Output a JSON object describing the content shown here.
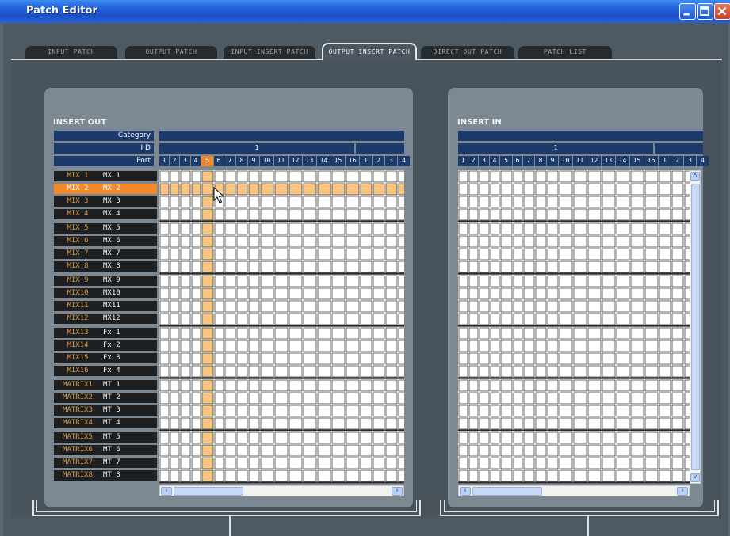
{
  "window": {
    "title": "Patch Editor",
    "buttons": {
      "minimize": "minimize-icon",
      "maximize": "maximize-icon",
      "close": "close-icon"
    }
  },
  "tabs": [
    {
      "label": "INPUT PATCH",
      "active": false
    },
    {
      "label": "OUTPUT PATCH",
      "active": false
    },
    {
      "label": "INPUT INSERT PATCH",
      "active": false
    },
    {
      "label": "OUTPUT INSERT PATCH",
      "active": true
    },
    {
      "label": "DIRECT OUT PATCH",
      "active": false
    },
    {
      "label": "PATCH LIST",
      "active": false
    }
  ],
  "insert_out": {
    "title": "INSERT OUT",
    "header_labels": {
      "category": "Category",
      "id": "I D",
      "port": "Port"
    },
    "id_value": "1",
    "ports": [
      "1",
      "2",
      "3",
      "4",
      "5",
      "6",
      "7",
      "8",
      "9",
      "10",
      "11",
      "12",
      "13",
      "14",
      "15",
      "16",
      "1",
      "2",
      "3",
      "4"
    ],
    "selected_port": "5",
    "rows": [
      {
        "name": "MIX 1",
        "short": "MX 1"
      },
      {
        "name": "MIX 2",
        "short": "MX 2",
        "selected": true
      },
      {
        "name": "MIX 3",
        "short": "MX 3"
      },
      {
        "name": "MIX 4",
        "short": "MX 4"
      },
      {
        "name": "MIX 5",
        "short": "MX 5"
      },
      {
        "name": "MIX 6",
        "short": "MX 6"
      },
      {
        "name": "MIX 7",
        "short": "MX 7"
      },
      {
        "name": "MIX 8",
        "short": "MX 8"
      },
      {
        "name": "MIX 9",
        "short": "MX 9"
      },
      {
        "name": "MIX10",
        "short": "MX10"
      },
      {
        "name": "MIX11",
        "short": "MX11"
      },
      {
        "name": "MIX12",
        "short": "MX12"
      },
      {
        "name": "MIX13",
        "short": "Fx 1"
      },
      {
        "name": "MIX14",
        "short": "Fx 2"
      },
      {
        "name": "MIX15",
        "short": "Fx 3"
      },
      {
        "name": "MIX16",
        "short": "Fx 4"
      },
      {
        "name": "MATRIX1",
        "short": "MT 1"
      },
      {
        "name": "MATRIX2",
        "short": "MT 2"
      },
      {
        "name": "MATRIX3",
        "short": "MT 3"
      },
      {
        "name": "MATRIX4",
        "short": "MT 4"
      },
      {
        "name": "MATRIX5",
        "short": "MT 5"
      },
      {
        "name": "MATRIX6",
        "short": "MT 6"
      },
      {
        "name": "MATRIX7",
        "short": "MT 7"
      },
      {
        "name": "MATRIX8",
        "short": "MT 8"
      }
    ],
    "scroll_left": "‹",
    "scroll_right": "›"
  },
  "insert_in": {
    "title": "INSERT IN",
    "id_value": "1",
    "ports": [
      "1",
      "2",
      "3",
      "4",
      "5",
      "6",
      "7",
      "8",
      "9",
      "10",
      "11",
      "12",
      "13",
      "14",
      "15",
      "16",
      "1",
      "2",
      "3",
      "4"
    ],
    "scroll_left": "‹",
    "scroll_right": "›",
    "scroll_up": "˄",
    "scroll_down": "˅"
  },
  "colors": {
    "highlight": "#f9c583",
    "selected_label": "#f08a2c",
    "header_blue": "#1c3a6b",
    "panel_gray": "#7c8992"
  },
  "cursor": "pointer-cursor-icon"
}
